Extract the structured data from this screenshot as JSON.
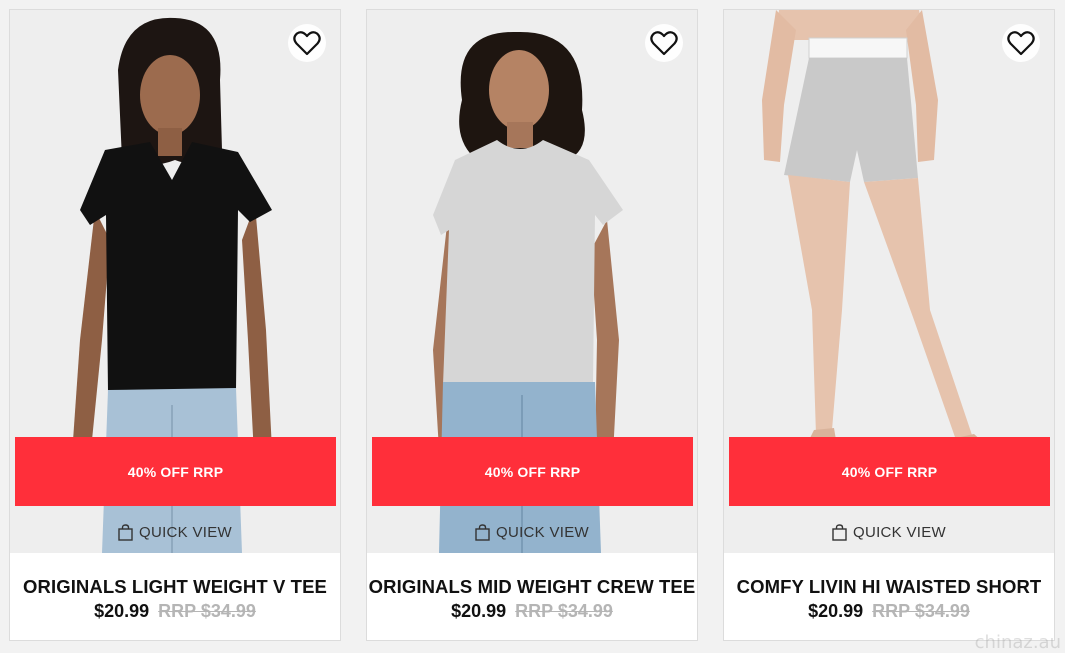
{
  "colors": {
    "promo": "#ff2f3a",
    "rrp": "#b5b5b5"
  },
  "products": [
    {
      "name": "ORIGINALS LIGHT WEIGHT V TEE",
      "price": "$20.99",
      "rrp": "RRP $34.99",
      "promo": "40% OFF RRP",
      "quick_view": "QUICK VIEW",
      "wishlist_icon": "heart-outline-icon",
      "quick_view_icon": "shopping-bag-icon"
    },
    {
      "name": "ORIGINALS MID WEIGHT CREW TEE",
      "price": "$20.99",
      "rrp": "RRP $34.99",
      "promo": "40% OFF RRP",
      "quick_view": "QUICK VIEW",
      "wishlist_icon": "heart-outline-icon",
      "quick_view_icon": "shopping-bag-icon"
    },
    {
      "name": "COMFY LIVIN HI WAISTED SHORT",
      "price": "$20.99",
      "rrp": "RRP $34.99",
      "promo": "40% OFF RRP",
      "quick_view": "QUICK VIEW",
      "wishlist_icon": "heart-outline-icon",
      "quick_view_icon": "shopping-bag-icon"
    }
  ],
  "watermark": "chinaz.au"
}
